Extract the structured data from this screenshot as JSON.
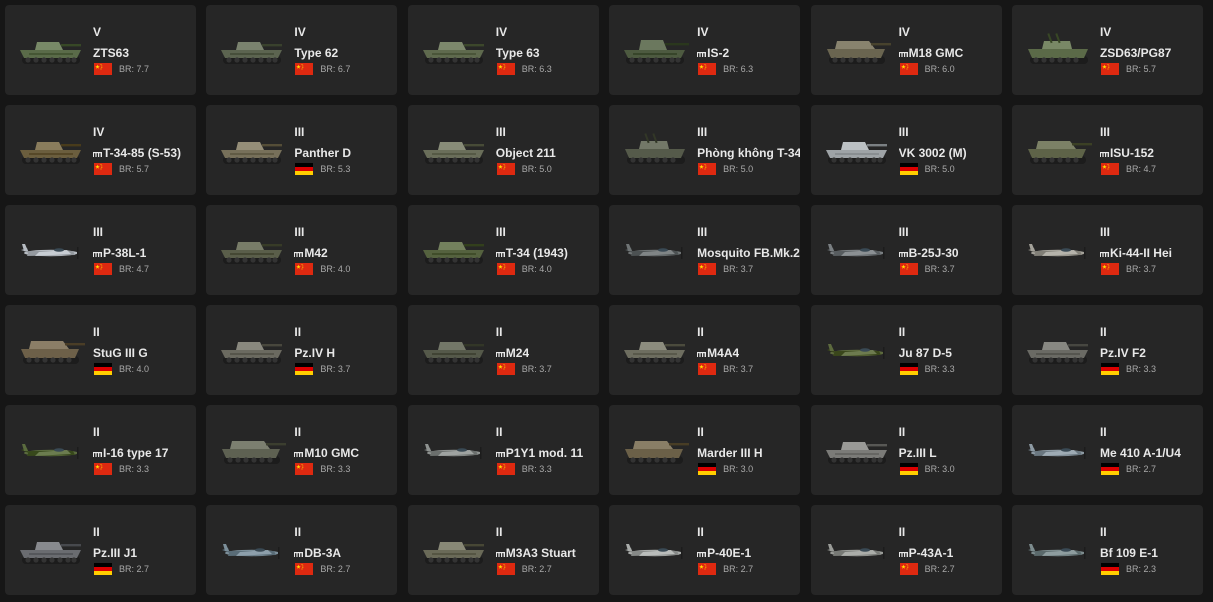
{
  "br_prefix": "BR: ",
  "vehicles": [
    {
      "rank": "V",
      "name": "ZTS63",
      "prefixed": false,
      "nation": "china",
      "br": "7.7",
      "type": "light-tank",
      "camo": "#5a6b49"
    },
    {
      "rank": "IV",
      "name": "Type 62",
      "prefixed": false,
      "nation": "china",
      "br": "6.7",
      "type": "light-tank",
      "camo": "#5c6450"
    },
    {
      "rank": "IV",
      "name": "Type 63",
      "prefixed": false,
      "nation": "china",
      "br": "6.3",
      "type": "light-tank",
      "camo": "#5f6a4e"
    },
    {
      "rank": "IV",
      "name": "IS-2",
      "prefixed": true,
      "nation": "china",
      "br": "6.3",
      "type": "heavy-tank",
      "camo": "#4d5a40"
    },
    {
      "rank": "IV",
      "name": "M18 GMC",
      "prefixed": true,
      "nation": "china",
      "br": "6.0",
      "type": "tank-destroyer",
      "camo": "#6a6550"
    },
    {
      "rank": "IV",
      "name": "ZSD63/PG87",
      "prefixed": false,
      "nation": "china",
      "br": "5.7",
      "type": "spaa",
      "camo": "#5b6a48"
    },
    {
      "rank": "IV",
      "name": "T-34-85 (S-53)",
      "prefixed": true,
      "nation": "china",
      "br": "5.7",
      "type": "medium-tank",
      "camo": "#6b5e3e"
    },
    {
      "rank": "III",
      "name": "Panther D",
      "prefixed": false,
      "nation": "germany",
      "br": "5.3",
      "type": "medium-tank",
      "camo": "#77705a"
    },
    {
      "rank": "III",
      "name": "Object 211",
      "prefixed": false,
      "nation": "china",
      "br": "5.0",
      "type": "light-tank",
      "camo": "#6a6e5a"
    },
    {
      "rank": "III",
      "name": "Phòng không T-34",
      "prefixed": false,
      "nation": "china",
      "br": "5.0",
      "type": "spaa",
      "camo": "#555a4a"
    },
    {
      "rank": "III",
      "name": "VK 3002 (M)",
      "prefixed": false,
      "nation": "germany",
      "br": "5.0",
      "type": "medium-tank",
      "camo": "#9ea3a6"
    },
    {
      "rank": "III",
      "name": "ISU-152",
      "prefixed": true,
      "nation": "china",
      "br": "4.7",
      "type": "tank-destroyer",
      "camo": "#5e6348"
    },
    {
      "rank": "III",
      "name": "P-38L-1",
      "prefixed": true,
      "nation": "china",
      "br": "4.7",
      "type": "aircraft",
      "camo": "#b7bcc2"
    },
    {
      "rank": "III",
      "name": "M42",
      "prefixed": true,
      "nation": "china",
      "br": "4.0",
      "type": "light-tank",
      "camo": "#5a5e4a"
    },
    {
      "rank": "III",
      "name": "T-34 (1943)",
      "prefixed": true,
      "nation": "china",
      "br": "4.0",
      "type": "medium-tank",
      "camo": "#55623f"
    },
    {
      "rank": "III",
      "name": "Mosquito FB.Mk.2",
      "prefixed": false,
      "nation": "china",
      "br": "3.7",
      "type": "aircraft",
      "camo": "#6f7475"
    },
    {
      "rank": "III",
      "name": "B-25J-30",
      "prefixed": true,
      "nation": "china",
      "br": "3.7",
      "type": "aircraft",
      "camo": "#7a7f82"
    },
    {
      "rank": "III",
      "name": "Ki-44-II Hei",
      "prefixed": true,
      "nation": "china",
      "br": "3.7",
      "type": "aircraft",
      "camo": "#a4a29a"
    },
    {
      "rank": "II",
      "name": "StuG III G",
      "prefixed": false,
      "nation": "germany",
      "br": "4.0",
      "type": "tank-destroyer",
      "camo": "#6d6049"
    },
    {
      "rank": "II",
      "name": "Pz.IV H",
      "prefixed": false,
      "nation": "germany",
      "br": "3.7",
      "type": "medium-tank",
      "camo": "#6b6a60"
    },
    {
      "rank": "II",
      "name": "M24",
      "prefixed": true,
      "nation": "china",
      "br": "3.7",
      "type": "light-tank",
      "camo": "#55594a"
    },
    {
      "rank": "II",
      "name": "M4A4",
      "prefixed": true,
      "nation": "china",
      "br": "3.7",
      "type": "medium-tank",
      "camo": "#6e6e60"
    },
    {
      "rank": "II",
      "name": "Ju 87 D-5",
      "prefixed": false,
      "nation": "germany",
      "br": "3.3",
      "type": "aircraft",
      "camo": "#5d6a3e"
    },
    {
      "rank": "II",
      "name": "Pz.IV F2",
      "prefixed": false,
      "nation": "germany",
      "br": "3.3",
      "type": "medium-tank",
      "camo": "#6a6a64"
    },
    {
      "rank": "II",
      "name": "I-16 type 17",
      "prefixed": true,
      "nation": "china",
      "br": "3.3",
      "type": "aircraft",
      "camo": "#5a6b3e"
    },
    {
      "rank": "II",
      "name": "M10 GMC",
      "prefixed": true,
      "nation": "china",
      "br": "3.3",
      "type": "tank-destroyer",
      "camo": "#5e6152"
    },
    {
      "rank": "II",
      "name": "P1Y1 mod. 11",
      "prefixed": true,
      "nation": "china",
      "br": "3.3",
      "type": "aircraft",
      "camo": "#8e9290"
    },
    {
      "rank": "II",
      "name": "Marder III H",
      "prefixed": false,
      "nation": "germany",
      "br": "3.0",
      "type": "tank-destroyer",
      "camo": "#6b6048"
    },
    {
      "rank": "II",
      "name": "Pz.III L",
      "prefixed": false,
      "nation": "germany",
      "br": "3.0",
      "type": "medium-tank",
      "camo": "#7b7b78"
    },
    {
      "rank": "II",
      "name": "Me 410 A-1/U4",
      "prefixed": false,
      "nation": "germany",
      "br": "2.7",
      "type": "aircraft",
      "camo": "#8d9aa3"
    },
    {
      "rank": "II",
      "name": "Pz.III J1",
      "prefixed": false,
      "nation": "germany",
      "br": "2.7",
      "type": "medium-tank",
      "camo": "#6a6c70"
    },
    {
      "rank": "II",
      "name": "DB-3A",
      "prefixed": true,
      "nation": "china",
      "br": "2.7",
      "type": "aircraft",
      "camo": "#7c8f9a"
    },
    {
      "rank": "II",
      "name": "M3A3 Stuart",
      "prefixed": true,
      "nation": "china",
      "br": "2.7",
      "type": "light-tank",
      "camo": "#6a6a58"
    },
    {
      "rank": "II",
      "name": "P-40E-1",
      "prefixed": true,
      "nation": "china",
      "br": "2.7",
      "type": "aircraft",
      "camo": "#a9acaa"
    },
    {
      "rank": "II",
      "name": "P-43A-1",
      "prefixed": true,
      "nation": "china",
      "br": "2.7",
      "type": "aircraft",
      "camo": "#9a9c98"
    },
    {
      "rank": "II",
      "name": "Bf 109 E-1",
      "prefixed": false,
      "nation": "germany",
      "br": "2.3",
      "type": "aircraft",
      "camo": "#7d8c8e"
    }
  ]
}
